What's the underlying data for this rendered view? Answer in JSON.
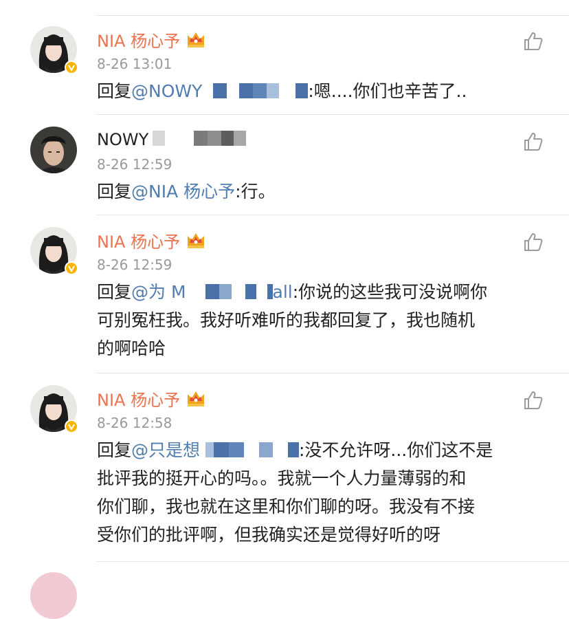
{
  "comments": [
    {
      "author": "NIA 杨心予",
      "time": "8-26 13:01",
      "reply_prefix": "回复",
      "mention": "@NOWY",
      "text": ":嗯....你们也辛苦了.."
    },
    {
      "author": "NOWY",
      "time": "8-26 12:59",
      "reply_prefix": "回复",
      "mention": "@NIA 杨心予",
      "text": ":行。"
    },
    {
      "author": "NIA 杨心予",
      "time": "8-26 12:59",
      "reply_prefix": "回复",
      "mention": "@为 M",
      "mention_tail": "all",
      "text_line1": ":你说的这些我可没说啊你",
      "text_line2": "可别冤枉我。我好听难听的我都回复了，我也随机",
      "text_line3": "的啊哈哈"
    },
    {
      "author": "NIA 杨心予",
      "time": "8-26 12:58",
      "reply_prefix": "回复",
      "mention": "@只是想",
      "text_line1": ":没不允许呀...你们这不是",
      "text_line2": "批评我的挺开心的吗。。我就一个人力量薄弱的和",
      "text_line3": "你们聊，我也就在这里和你们聊的呀。我没有不接",
      "text_line4": "受你们的批评啊，但我确实还是觉得好听的呀"
    }
  ],
  "icons": {
    "like": "thumbs-up-icon",
    "crown": "crown-icon",
    "verified": "verified-v-icon"
  },
  "colors": {
    "author_orange": "#eb7350",
    "mention_blue": "#507daf",
    "time_gray": "#999999",
    "text": "#222222",
    "verified_gold": "#f7b500"
  }
}
